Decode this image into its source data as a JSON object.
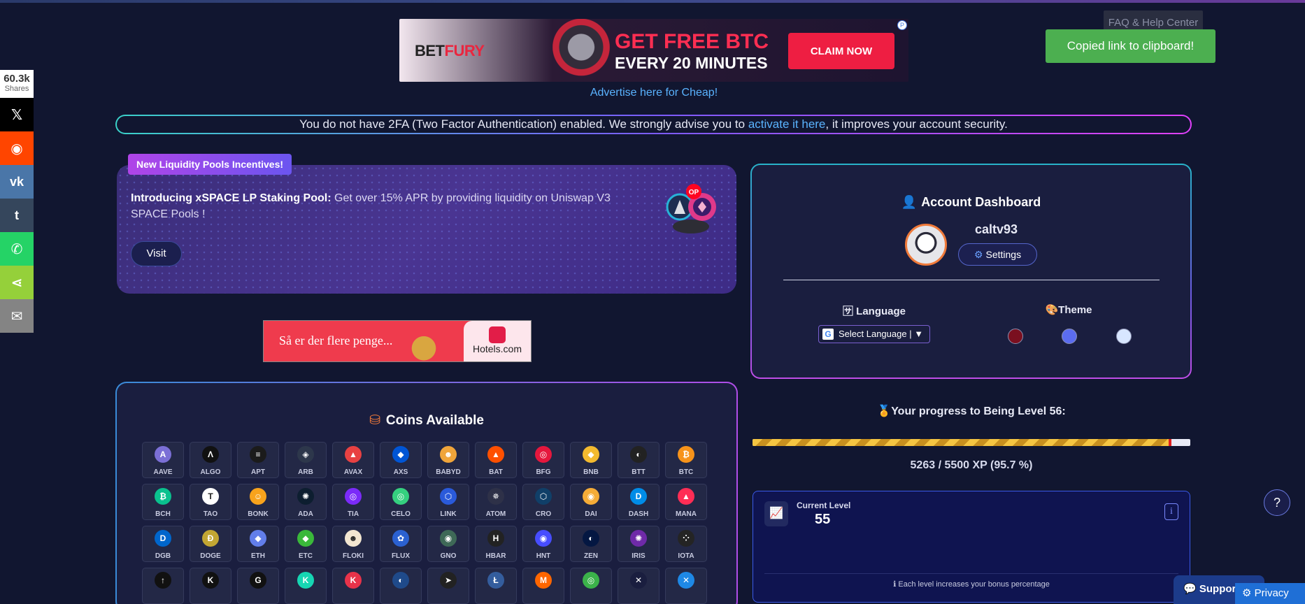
{
  "share": {
    "count": "60.3k",
    "count_label": "Shares",
    "buttons": [
      {
        "name": "x",
        "glyph": "𝕏",
        "color": "#000000"
      },
      {
        "name": "reddit",
        "glyph": "◉",
        "color": "#ff4500"
      },
      {
        "name": "vk",
        "glyph": "vk",
        "color": "#4a76a8"
      },
      {
        "name": "tumblr",
        "glyph": "t",
        "color": "#35465c"
      },
      {
        "name": "whatsapp",
        "glyph": "✆",
        "color": "#25d366"
      },
      {
        "name": "sharethis",
        "glyph": "⋖",
        "color": "#95d03a"
      },
      {
        "name": "email",
        "glyph": "✉",
        "color": "#848484"
      }
    ]
  },
  "banner": {
    "logo_bet": "BET",
    "logo_fury": "FURY",
    "headline": "GET FREE BTC",
    "subline": "EVERY 20 MINUTES",
    "cta": "CLAIM NOW"
  },
  "advertise_link": "Advertise here for Cheap!",
  "faq": "FAQ & Help Center",
  "toast": "Copied link to clipboard!",
  "twofa": {
    "before": "You do not have 2FA (Two Factor Authentication) enabled. We strongly advise you to ",
    "link": "activate it here",
    "after": ", it improves your account security."
  },
  "promo": {
    "tag": "New Liquidity Pools Incentives!",
    "bold": "Introducing xSPACE LP Staking Pool:",
    "text": " Get over 15% APR by providing liquidity on Uniswap V3 SPACE Pools !",
    "button": "Visit",
    "badge": "OP"
  },
  "hotels_ad": {
    "text": "Så er der flere penge...",
    "brand": "Hotels.com"
  },
  "coins": {
    "title": "Coins Available",
    "items": [
      {
        "symbol": "AAVE",
        "glyph": "A",
        "color": "#7b6fd6"
      },
      {
        "symbol": "ALGO",
        "glyph": "Λ",
        "color": "#111111"
      },
      {
        "symbol": "APT",
        "glyph": "≡",
        "color": "#1b1b1b"
      },
      {
        "symbol": "ARB",
        "glyph": "◈",
        "color": "#2d374b"
      },
      {
        "symbol": "AVAX",
        "glyph": "▲",
        "color": "#e84142"
      },
      {
        "symbol": "AXS",
        "glyph": "◆",
        "color": "#0055d5"
      },
      {
        "symbol": "BABYD",
        "glyph": "☻",
        "color": "#f0a53a"
      },
      {
        "symbol": "BAT",
        "glyph": "▲",
        "color": "#ff5000"
      },
      {
        "symbol": "BFG",
        "glyph": "◎",
        "color": "#e6173d"
      },
      {
        "symbol": "BNB",
        "glyph": "◆",
        "color": "#f3ba2f"
      },
      {
        "symbol": "BTT",
        "glyph": "◐",
        "color": "#222222"
      },
      {
        "symbol": "BTC",
        "glyph": "₿",
        "color": "#f7931a"
      },
      {
        "symbol": "BCH",
        "glyph": "₿",
        "color": "#0ac18e"
      },
      {
        "symbol": "TAO",
        "glyph": "T",
        "color": "#ffffff"
      },
      {
        "symbol": "BONK",
        "glyph": "☺",
        "color": "#f8a31c"
      },
      {
        "symbol": "ADA",
        "glyph": "✺",
        "color": "#0d1e30"
      },
      {
        "symbol": "TIA",
        "glyph": "◎",
        "color": "#7b2bf9"
      },
      {
        "symbol": "CELO",
        "glyph": "◎",
        "color": "#35d07f"
      },
      {
        "symbol": "LINK",
        "glyph": "⬡",
        "color": "#2a5ada"
      },
      {
        "symbol": "ATOM",
        "glyph": "✵",
        "color": "#2e3148"
      },
      {
        "symbol": "CRO",
        "glyph": "⬡",
        "color": "#103f68"
      },
      {
        "symbol": "DAI",
        "glyph": "◉",
        "color": "#f5ac37"
      },
      {
        "symbol": "DASH",
        "glyph": "D",
        "color": "#008ce7"
      },
      {
        "symbol": "MANA",
        "glyph": "▲",
        "color": "#ff2d55"
      },
      {
        "symbol": "DGB",
        "glyph": "D",
        "color": "#0066cc"
      },
      {
        "symbol": "DOGE",
        "glyph": "Ð",
        "color": "#c2a633"
      },
      {
        "symbol": "ETH",
        "glyph": "◆",
        "color": "#627eea"
      },
      {
        "symbol": "ETC",
        "glyph": "◆",
        "color": "#3ab83a"
      },
      {
        "symbol": "FLOKI",
        "glyph": "☻",
        "color": "#f2e6d0"
      },
      {
        "symbol": "FLUX",
        "glyph": "✿",
        "color": "#2b61d1"
      },
      {
        "symbol": "GNO",
        "glyph": "◉",
        "color": "#3e6957"
      },
      {
        "symbol": "HBAR",
        "glyph": "H",
        "color": "#222222"
      },
      {
        "symbol": "HNT",
        "glyph": "◉",
        "color": "#474dff"
      },
      {
        "symbol": "ZEN",
        "glyph": "◐",
        "color": "#041742"
      },
      {
        "symbol": "IRIS",
        "glyph": "✺",
        "color": "#6f2aa8"
      },
      {
        "symbol": "IOTA",
        "glyph": "⁘",
        "color": "#242424"
      },
      {
        "symbol": "",
        "glyph": "↑",
        "color": "#111111"
      },
      {
        "symbol": "",
        "glyph": "K",
        "color": "#111111"
      },
      {
        "symbol": "",
        "glyph": "G",
        "color": "#111111"
      },
      {
        "symbol": "",
        "glyph": "K",
        "color": "#16d6b3"
      },
      {
        "symbol": "",
        "glyph": "K",
        "color": "#e8334a"
      },
      {
        "symbol": "",
        "glyph": "◐",
        "color": "#1f4a8a"
      },
      {
        "symbol": "",
        "glyph": "➤",
        "color": "#222222"
      },
      {
        "symbol": "",
        "glyph": "Ł",
        "color": "#345d9d"
      },
      {
        "symbol": "",
        "glyph": "M",
        "color": "#ff6600"
      },
      {
        "symbol": "",
        "glyph": "◎",
        "color": "#3bb24a"
      },
      {
        "symbol": "",
        "glyph": "✕",
        "color": "#1a1e3f"
      },
      {
        "symbol": "",
        "glyph": "✕",
        "color": "#1e88e5"
      }
    ]
  },
  "account": {
    "title": "Account Dashboard",
    "username": "caltv93",
    "settings": "Settings",
    "language_label": "Language",
    "language_select": "Select Language",
    "theme_label": "Theme",
    "themes": [
      "#7a0f1f",
      "#5b6cf0",
      "#d8e6ff"
    ]
  },
  "progress": {
    "title": "Your progress to Being Level 56:",
    "fraction": 0.957,
    "text": "5263 / 5500 XP (95.7 %)"
  },
  "level": {
    "label": "Current Level",
    "value": "55",
    "info": "i",
    "note": "Each level increases your bonus percentage"
  },
  "help": "?",
  "support": "Support",
  "privacy": "Privacy"
}
